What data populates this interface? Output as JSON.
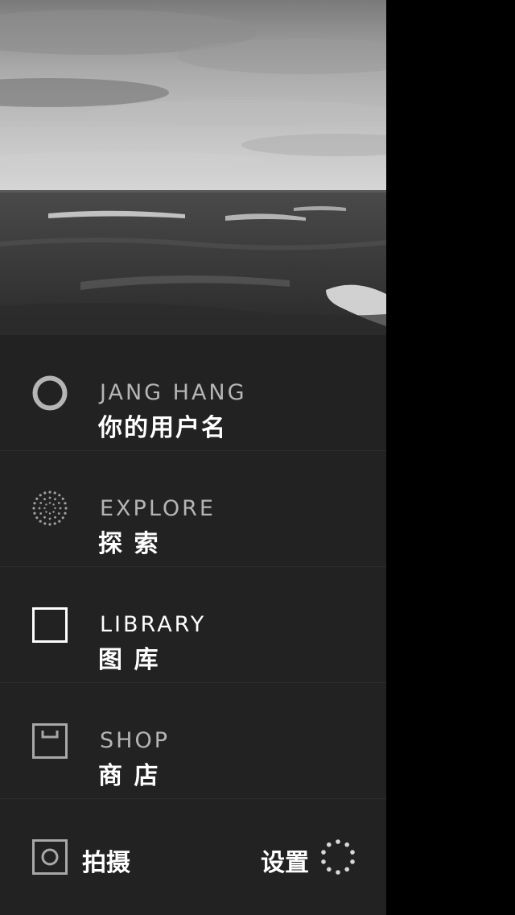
{
  "drawer": {
    "background_color": "#222222",
    "hero_image": {
      "subject": "black-and-white ocean waves under cloudy sky"
    }
  },
  "menu": {
    "items": [
      {
        "title": "JANG HANG",
        "subtitle": "你的用户名",
        "icon": "profile-ring-icon"
      },
      {
        "title": "EXPLORE",
        "subtitle": "探 索",
        "icon": "dotted-circle-icon"
      },
      {
        "title": "LIBRARY",
        "subtitle": "图 库",
        "icon": "square-icon"
      },
      {
        "title": "SHOP",
        "subtitle": "商 店",
        "icon": "shop-box-icon"
      }
    ]
  },
  "footer": {
    "capture_label": "拍摄",
    "capture_icon": "camera-icon",
    "settings_label": "设置",
    "settings_icon": "dotted-settings-icon"
  },
  "colors": {
    "text_primary": "#ffffff",
    "text_muted": "#b5b5b5",
    "page_background": "#000000"
  }
}
